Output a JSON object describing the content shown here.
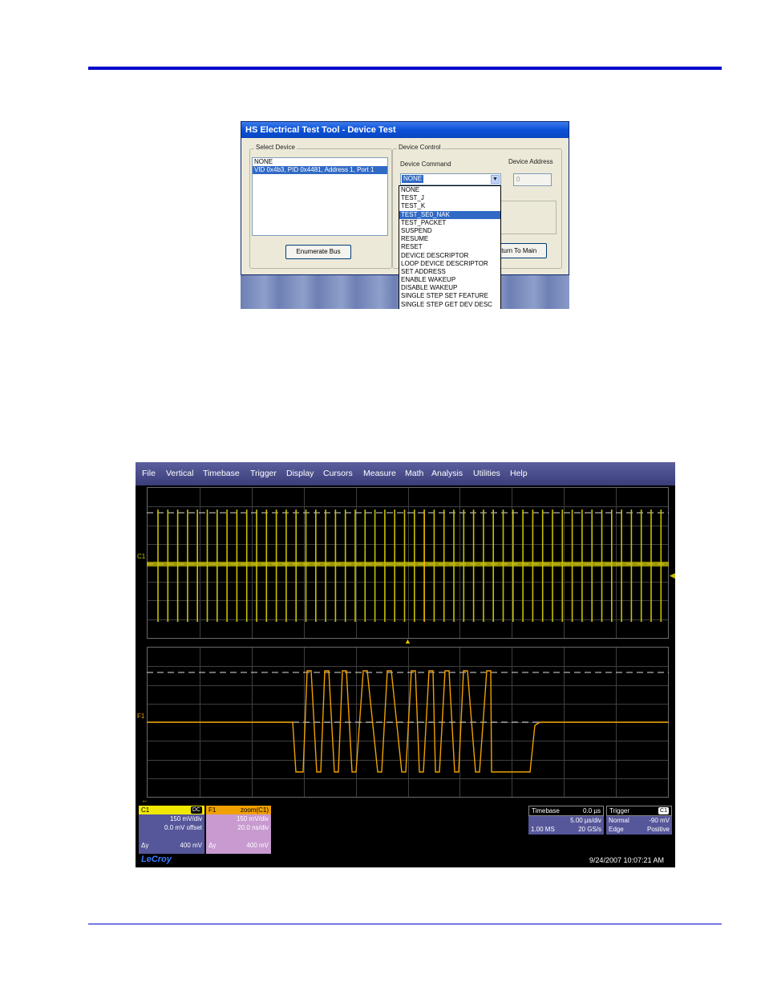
{
  "dialog": {
    "title": "HS Electrical Test Tool - Device Test",
    "select_device": {
      "label": "Select Device",
      "items": [
        "NONE",
        "VID 0x4b3, PID 0x4481, Address 1, Port 1"
      ],
      "selected_index": 1
    },
    "enumerate_button": "Enumerate Bus",
    "device_control": {
      "label": "Device Control",
      "command_label": "Device Command",
      "address_label": "Device Address",
      "command_value": "NONE",
      "address_value": "0"
    },
    "dropdown_items": [
      "NONE",
      "TEST_J",
      "TEST_K",
      "TEST_SE0_NAK",
      "TEST_PACKET",
      "SUSPEND",
      "RESUME",
      "RESET",
      "DEVICE DESCRIPTOR",
      "LOOP DEVICE DESCRIPTOR",
      "SET ADDRESS",
      "ENABLE WAKEUP",
      "DISABLE WAKEUP",
      "SINGLE STEP SET FEATURE",
      "SINGLE STEP GET DEV DESC"
    ],
    "highlighted_index": 3,
    "return_button": "eturn To Main"
  },
  "scope": {
    "menu": [
      "File",
      "Vertical",
      "Timebase",
      "Trigger",
      "Display",
      "Cursors",
      "Measure",
      "Math",
      "Analysis",
      "Utilities",
      "Help"
    ],
    "trace1_label": "C1",
    "trace2_label": "F1",
    "colors": {
      "c1": "#c8c000",
      "f1": "#f0a000",
      "menubar": "#4a4d8a",
      "f1_panel": "#c89ad0"
    },
    "c1": {
      "name": "C1",
      "coupling": "DC",
      "vdiv": "150 mV/div",
      "offset": "0.0 mV offset",
      "dy_label": "Δy",
      "dy": "400 mV"
    },
    "f1": {
      "name": "F1",
      "source": "zoom(C1)",
      "vdiv": "150 mV/div",
      "tdiv": "20.0 ns/div",
      "dy_label": "Δy",
      "dy": "400 mV"
    },
    "timebase": {
      "label": "Timebase",
      "delay": "0.0 µs",
      "tdiv": "5.00 µs/div",
      "samples": "1.00 MS",
      "rate": "20 GS/s"
    },
    "trigger": {
      "label": "Trigger",
      "source": "C1",
      "mode": "Normal",
      "level": "-90 mV",
      "type": "Edge",
      "slope": "Positive"
    },
    "brand": "LeCroy",
    "timestamp": "9/24/2007 10:07:21 AM"
  }
}
